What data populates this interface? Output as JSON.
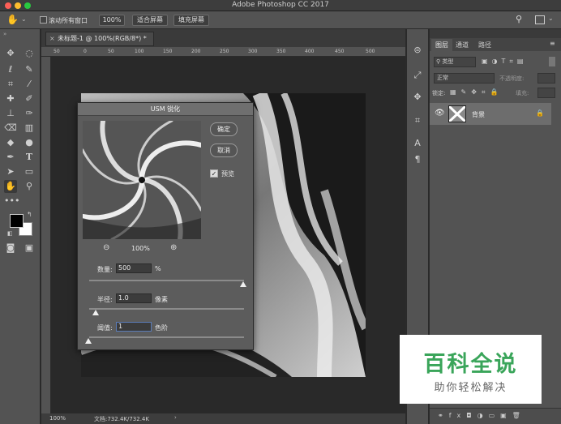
{
  "app_title": "Adobe Photoshop CC 2017",
  "options_bar": {
    "scroll_all": "滚动所有窗口",
    "zoom_100": "100%",
    "fit_screen": "适合屏幕",
    "fill_screen": "填充屏幕"
  },
  "doc_tab": "未标题-1 @ 100%(RGB/8*) *",
  "ruler_ticks": [
    "50",
    "0",
    "50",
    "100",
    "150",
    "200",
    "250",
    "300",
    "350",
    "400",
    "450",
    "500"
  ],
  "status": {
    "zoom": "100%",
    "doc": "文档:732.4K/732.4K"
  },
  "dialog": {
    "title": "USM 锐化",
    "ok": "确定",
    "cancel": "取消",
    "preview": "预览",
    "zoom": "100%",
    "amount_label": "数量:",
    "amount_value": "500",
    "amount_unit": "%",
    "amount_level": 1.0,
    "radius_label": "半径:",
    "radius_value": "1.0",
    "radius_unit": "像素",
    "threshold_label": "阈值:",
    "threshold_value": "1",
    "threshold_unit": "色阶"
  },
  "layers_panel": {
    "tabs": [
      "图层",
      "通道",
      "路径"
    ],
    "kind": "类型",
    "blend_mode": "正常",
    "opacity_label": "不透明度:",
    "lock_label": "锁定:",
    "fill_label": "填充:",
    "layer_name": "背景"
  },
  "watermark": {
    "title": "百科全说",
    "subtitle": "助你轻松解决"
  },
  "colors": {
    "accent_green": "#3aa55a",
    "panel_bg": "#535353"
  }
}
